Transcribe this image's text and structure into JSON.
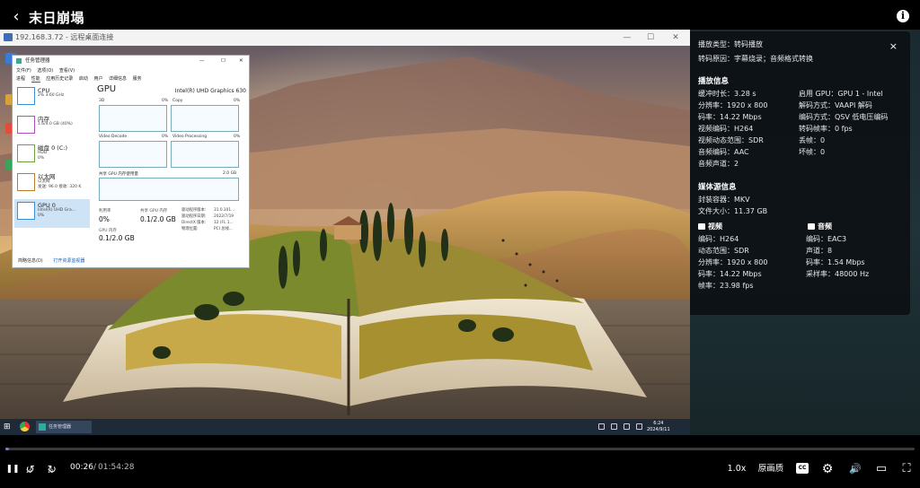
{
  "header": {
    "title": "末日崩塌",
    "back_icon": "‹",
    "info_icon": "i"
  },
  "remote": {
    "title": "192.168.3.72 - 远程桌面连接",
    "minimize": "—",
    "restore": "☐",
    "close": "✕"
  },
  "taskmgr": {
    "title": "任务管理器",
    "win_controls": [
      "—",
      "☐",
      "✕"
    ],
    "menu": [
      "文件(F)",
      "选项(O)",
      "查看(V)"
    ],
    "tabs": [
      "进程",
      "性能",
      "应用历史记录",
      "启动",
      "用户",
      "详细信息",
      "服务"
    ],
    "sidebar": [
      {
        "name": "CPU",
        "sub": "2% 3.60 GHz",
        "color": "#3b8fd9"
      },
      {
        "name": "内存",
        "sub": "1.6/4.0 GB (40%)",
        "color": "#b04fc4"
      },
      {
        "name": "磁盘 0 (C:)",
        "sub": "HDD\n0%",
        "color": "#6da33a"
      },
      {
        "name": "以太网",
        "sub": "以太网\n发送: 96.0 接收: 320 K",
        "color": "#c07a2b"
      },
      {
        "name": "GPU 0",
        "sub": "Intel(R) UHD Gra...\n0%",
        "color": "#3b8fd9"
      }
    ],
    "gpu_heading": "GPU",
    "gpu_model": "Intel(R) UHD Graphics 630",
    "graphs": [
      {
        "label": "3D",
        "pct": "0%"
      },
      {
        "label": "Copy",
        "pct": "0%"
      },
      {
        "label": "Video Decode",
        "pct": "0%"
      },
      {
        "label": "Video Processing",
        "pct": "0%"
      }
    ],
    "shared_label": "共享 GPU 内存使用量",
    "shared_max": "2.0 GB",
    "stats": {
      "util_label": "利用率",
      "util_value": "0%",
      "shared_label": "共享 GPU 内存",
      "shared_value": "0.1/2.0 GB",
      "gpu_mem_label": "GPU 内存",
      "gpu_mem_value": "0.1/2.0 GB"
    },
    "meta_keys": [
      "驱动程序版本:",
      "驱动程序日期:",
      "DirectX 版本:",
      "物理位置:"
    ],
    "meta_values": [
      "31.0.101...",
      "2022/7/19",
      "12 (FL 1...",
      "PCI 总线..."
    ],
    "footer_brief": "简略信息(D)",
    "footer_open": "打开资源监视器"
  },
  "inner_taskbar": {
    "start_icon": "⊞",
    "task_label": "任务管理器",
    "time": "6:24",
    "date": "2024/9/11"
  },
  "panel": {
    "close": "×",
    "playback_type": "播放类型：转码播放",
    "transcode_reason": "转码原因：字幕烧录；音频格式转换",
    "playback_heading": "播放信息",
    "playback_left": [
      "缓冲时长：3.28 s",
      "分辨率：1920 x 800",
      "码率：14.22 Mbps",
      "视频编码：H264",
      "视频动态范围：SDR",
      "音频编码：AAC",
      "音频声道：2"
    ],
    "playback_right": [
      "启用 GPU：GPU 1 - Intel",
      "解码方式：VAAPI 解码",
      "编码方式：QSV 低电压编码",
      "转码帧率：0 fps",
      "丢帧：0",
      "坏帧：0"
    ],
    "source_heading": "媒体源信息",
    "source_lines": [
      "封装容器：MKV",
      "文件大小：11.37 GB"
    ],
    "video_heading": "视频",
    "video_lines": [
      "编码：H264",
      "动态范围：SDR",
      "分辨率：1920 x 800",
      "码率：14.22 Mbps",
      "帧率：23.98 fps"
    ],
    "audio_heading": "音频",
    "audio_lines": [
      "编码：EAC3",
      "声道：8",
      "码率：1.54 Mbps",
      "采样率：48000 Hz"
    ]
  },
  "player": {
    "progress_fraction": 0.0042,
    "time_current": "00:26",
    "time_separator": "/",
    "time_total": "01:54:28",
    "speed": "1.0x",
    "quality": "原画质",
    "cc_icon": "CC",
    "pause_icon": "❚❚",
    "rewind_icon": "↺",
    "forward_icon": "↻",
    "rewind_label": "10",
    "forward_label": "10",
    "settings_icon": "⚙",
    "volume_icon": "🔊",
    "pip_icon": "▭",
    "fullscreen_icon": "⛶",
    "accent": "#6c7cd8"
  }
}
